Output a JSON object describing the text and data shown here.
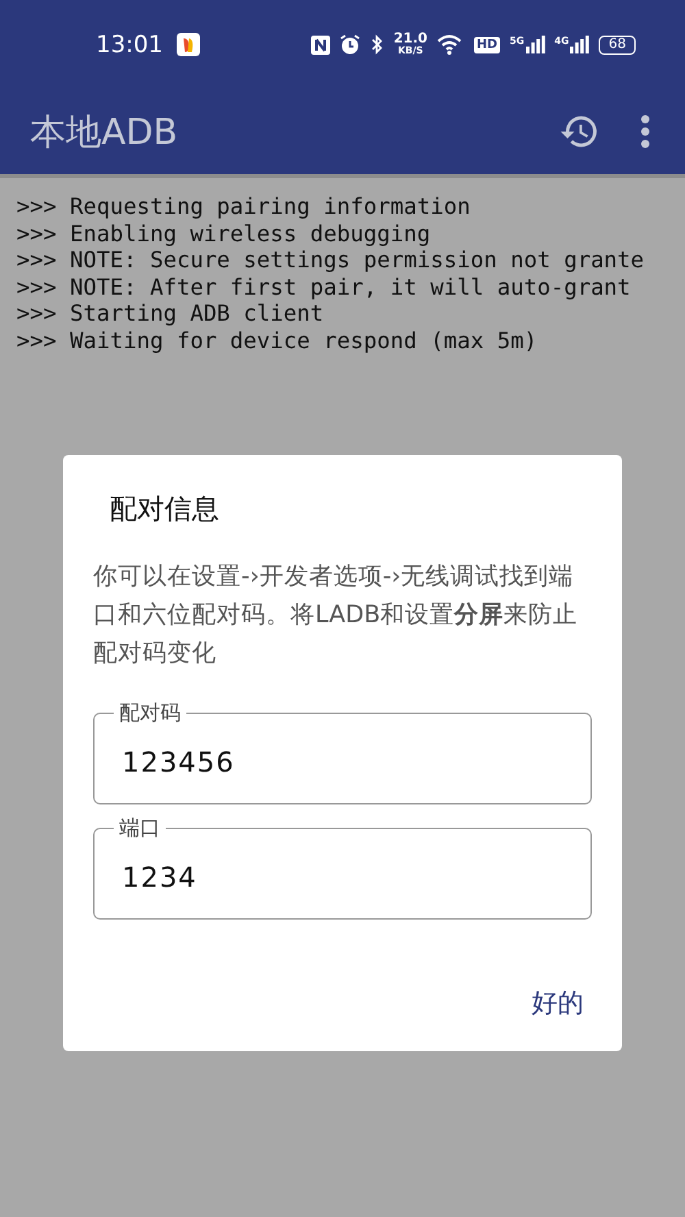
{
  "status_bar": {
    "time": "13:01",
    "network_speed": {
      "value": "21.0",
      "unit": "KB/S"
    },
    "signals": [
      {
        "label": "5G"
      },
      {
        "label": "4G"
      }
    ],
    "hd_badge": "HD",
    "battery": "68"
  },
  "app_bar": {
    "title": "本地ADB"
  },
  "log": [
    "Requesting pairing information",
    "Enabling wireless debugging",
    "NOTE: Secure settings permission not grante",
    "NOTE: After first pair, it will auto-grant",
    "Starting ADB client",
    "Waiting for device respond (max 5m)"
  ],
  "log_prefix": ">>>",
  "dialog": {
    "title": "配对信息",
    "message": "你可以在设置-›开发者选项-›无线调试找到端口和六位配对码。将LADB和设置**分屏**来防止配对码变化",
    "fields": [
      {
        "label": "配对码",
        "value": "123456"
      },
      {
        "label": "端口",
        "value": "1234"
      }
    ],
    "button": "好的"
  }
}
